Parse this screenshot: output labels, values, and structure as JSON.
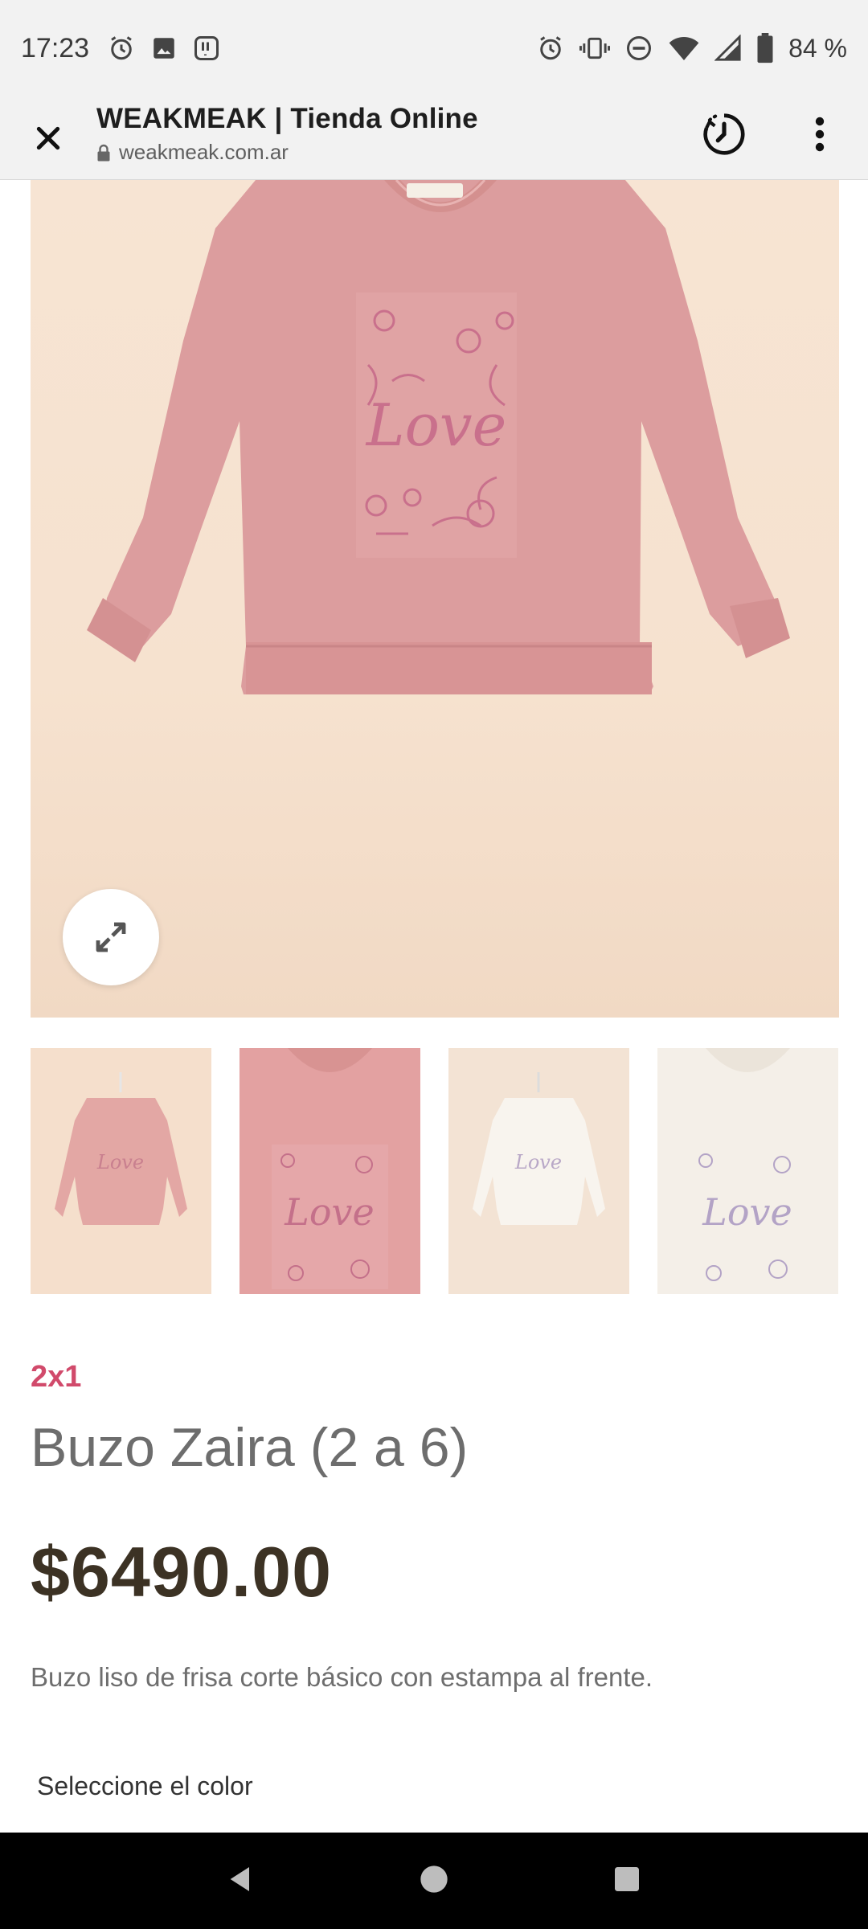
{
  "status_bar": {
    "time": "17:23",
    "battery": "84 %",
    "left_icons": [
      "alarm-icon",
      "image-icon",
      "ticket-icon"
    ],
    "right_icons": [
      "alarm-icon",
      "vibrate-icon",
      "dnd-icon",
      "wifi-icon",
      "signal-icon",
      "battery-icon"
    ]
  },
  "browser": {
    "title": "WEAKMEAK | Tienda Online",
    "url": "weakmeak.com.ar",
    "close_icon": "close-icon",
    "history_icon": "history-icon",
    "menu_icon": "more-vert-icon"
  },
  "product": {
    "main_image_alt": "",
    "zoom_icon": "expand-icon",
    "thumbnails": [
      {
        "variant": "pink-full",
        "color": "#e3a7a4"
      },
      {
        "variant": "pink-closeup",
        "color": "#e3a1a1"
      },
      {
        "variant": "white-full",
        "color": "#f6f1ea"
      },
      {
        "variant": "white-closeup",
        "color": "#f5efe8"
      }
    ],
    "promo": "2x1",
    "name": "Buzo Zaira (2 a 6)",
    "price": "$6490.00",
    "description": "Buzo liso de frisa corte básico con estampa al frente.",
    "color_label": "Seleccione el color"
  },
  "colors": {
    "promo": "#d14a6b",
    "price": "#3c3224",
    "sweater_pink": "#dc9d9e",
    "background_cream": "#f6e2cf"
  },
  "nav": {
    "back_icon": "back-triangle-icon",
    "home_icon": "home-circle-icon",
    "recents_icon": "recents-square-icon"
  }
}
